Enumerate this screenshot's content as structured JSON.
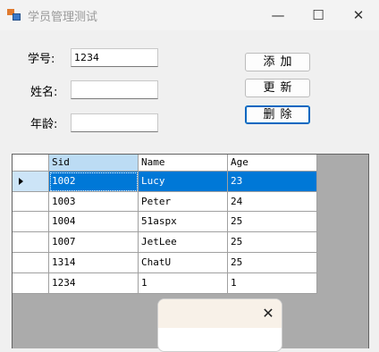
{
  "window": {
    "title": "学员管理测试",
    "controls": {
      "minimize": "—",
      "maximize": "☐",
      "close": "✕"
    }
  },
  "form": {
    "sid_label": "学号:",
    "sid_value": "1234",
    "name_label": "姓名:",
    "name_value": "",
    "age_label": "年龄:",
    "age_value": ""
  },
  "buttons": {
    "add": "添加",
    "update": "更新",
    "delete": "删除"
  },
  "table": {
    "columns": [
      "Sid",
      "Name",
      "Age"
    ],
    "rows": [
      [
        "1002",
        "Lucy",
        "23"
      ],
      [
        "1003",
        "Peter",
        "24"
      ],
      [
        "1004",
        "51aspx",
        "25"
      ],
      [
        "1007",
        "JetLee",
        "25"
      ],
      [
        "1314",
        "ChatU",
        "25"
      ],
      [
        "1234",
        "1",
        "1"
      ]
    ],
    "selected_row": 0
  },
  "popup": {
    "close": "✕"
  },
  "colors": {
    "selection": "#0078d7",
    "header_selected": "#bcdcf4",
    "focus_border": "#0067c0"
  }
}
